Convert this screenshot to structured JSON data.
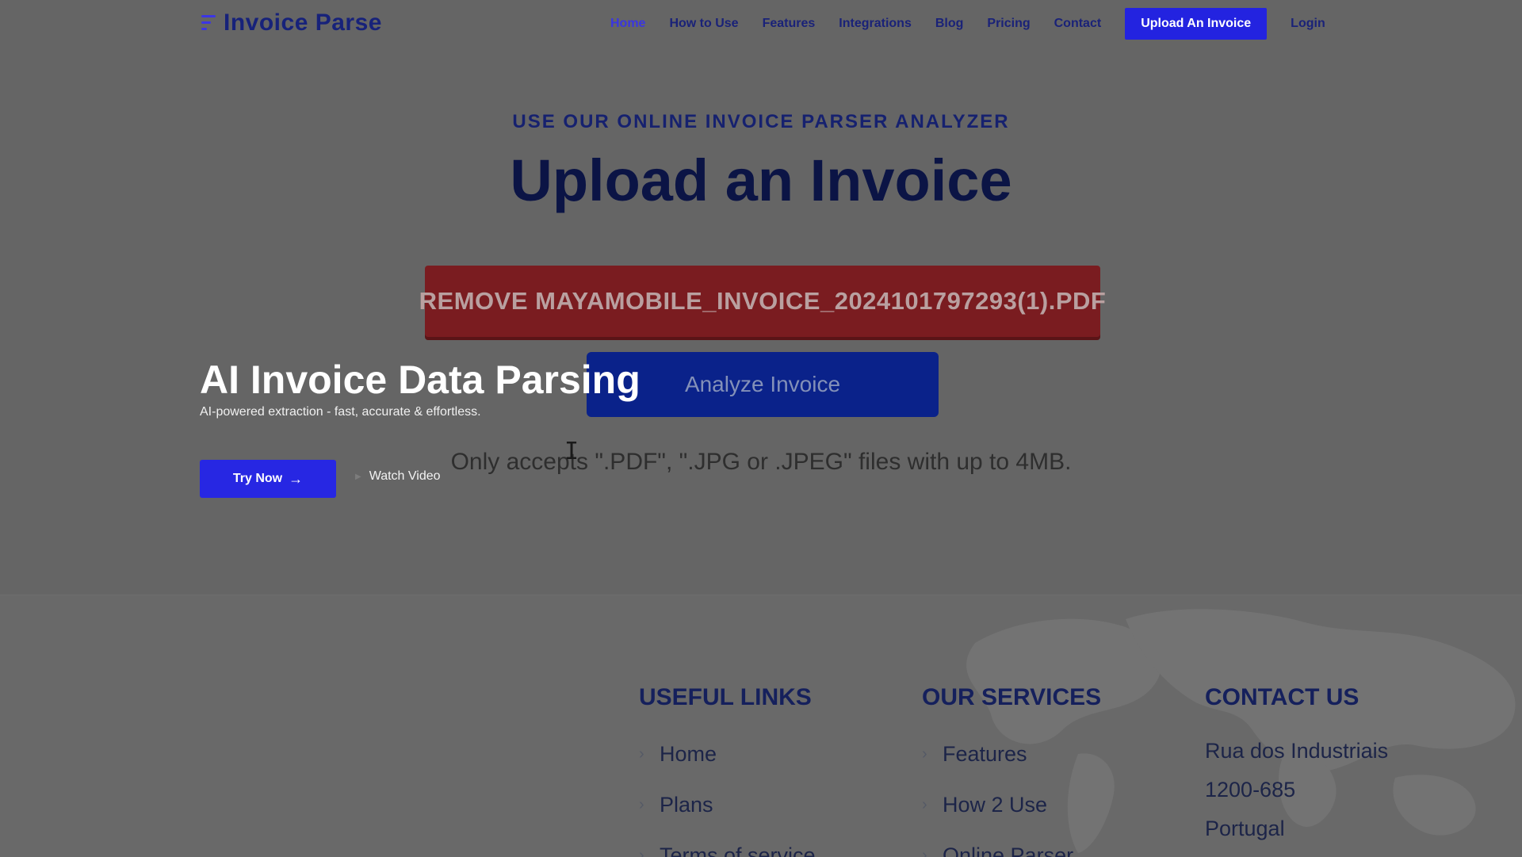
{
  "nav": {
    "logo_text": "Invoice Parse",
    "links": [
      {
        "label": "Home",
        "active": true
      },
      {
        "label": "How to Use"
      },
      {
        "label": "Features"
      },
      {
        "label": "Integrations"
      },
      {
        "label": "Blog"
      },
      {
        "label": "Pricing"
      },
      {
        "label": "Contact"
      }
    ],
    "upload_button": "Upload An Invoice",
    "login": "Login"
  },
  "upload": {
    "overline": "USE OUR ONLINE INVOICE PARSER ANALYZER",
    "title": "Upload an Invoice",
    "remove_label": "REMOVE MAYAMOBILE_INVOICE_2024101797293(1).PDF",
    "analyze_button": "Analyze Invoice",
    "accepts_note": "Only accepts \".PDF\", \".JPG or .JPEG\" files with up to 4MB."
  },
  "hero": {
    "title": "AI Invoice Data Parsing",
    "subtitle": "AI-powered extraction - fast, accurate & effortless.",
    "try_button": "Try Now",
    "try_icon": "arrow-right-icon",
    "watch_video": "Watch Video",
    "watch_icon": "play-icon"
  },
  "footer": {
    "useful_links": {
      "heading": "USEFUL LINKS",
      "items": [
        "Home",
        "Plans",
        "Terms of service"
      ]
    },
    "our_services": {
      "heading": "OUR SERVICES",
      "items": [
        "Features",
        "How 2 Use",
        "Online Parser"
      ]
    },
    "contact": {
      "heading": "CONTACT US",
      "lines": [
        "Rua dos Industriais",
        "1200-685",
        "Portugal"
      ]
    }
  },
  "colors": {
    "accent": "#2323e0",
    "navy": "#17227a",
    "remove_red": "#7a1c20",
    "analyze_blue": "#0a228a",
    "overlay_gray": "#656565"
  }
}
